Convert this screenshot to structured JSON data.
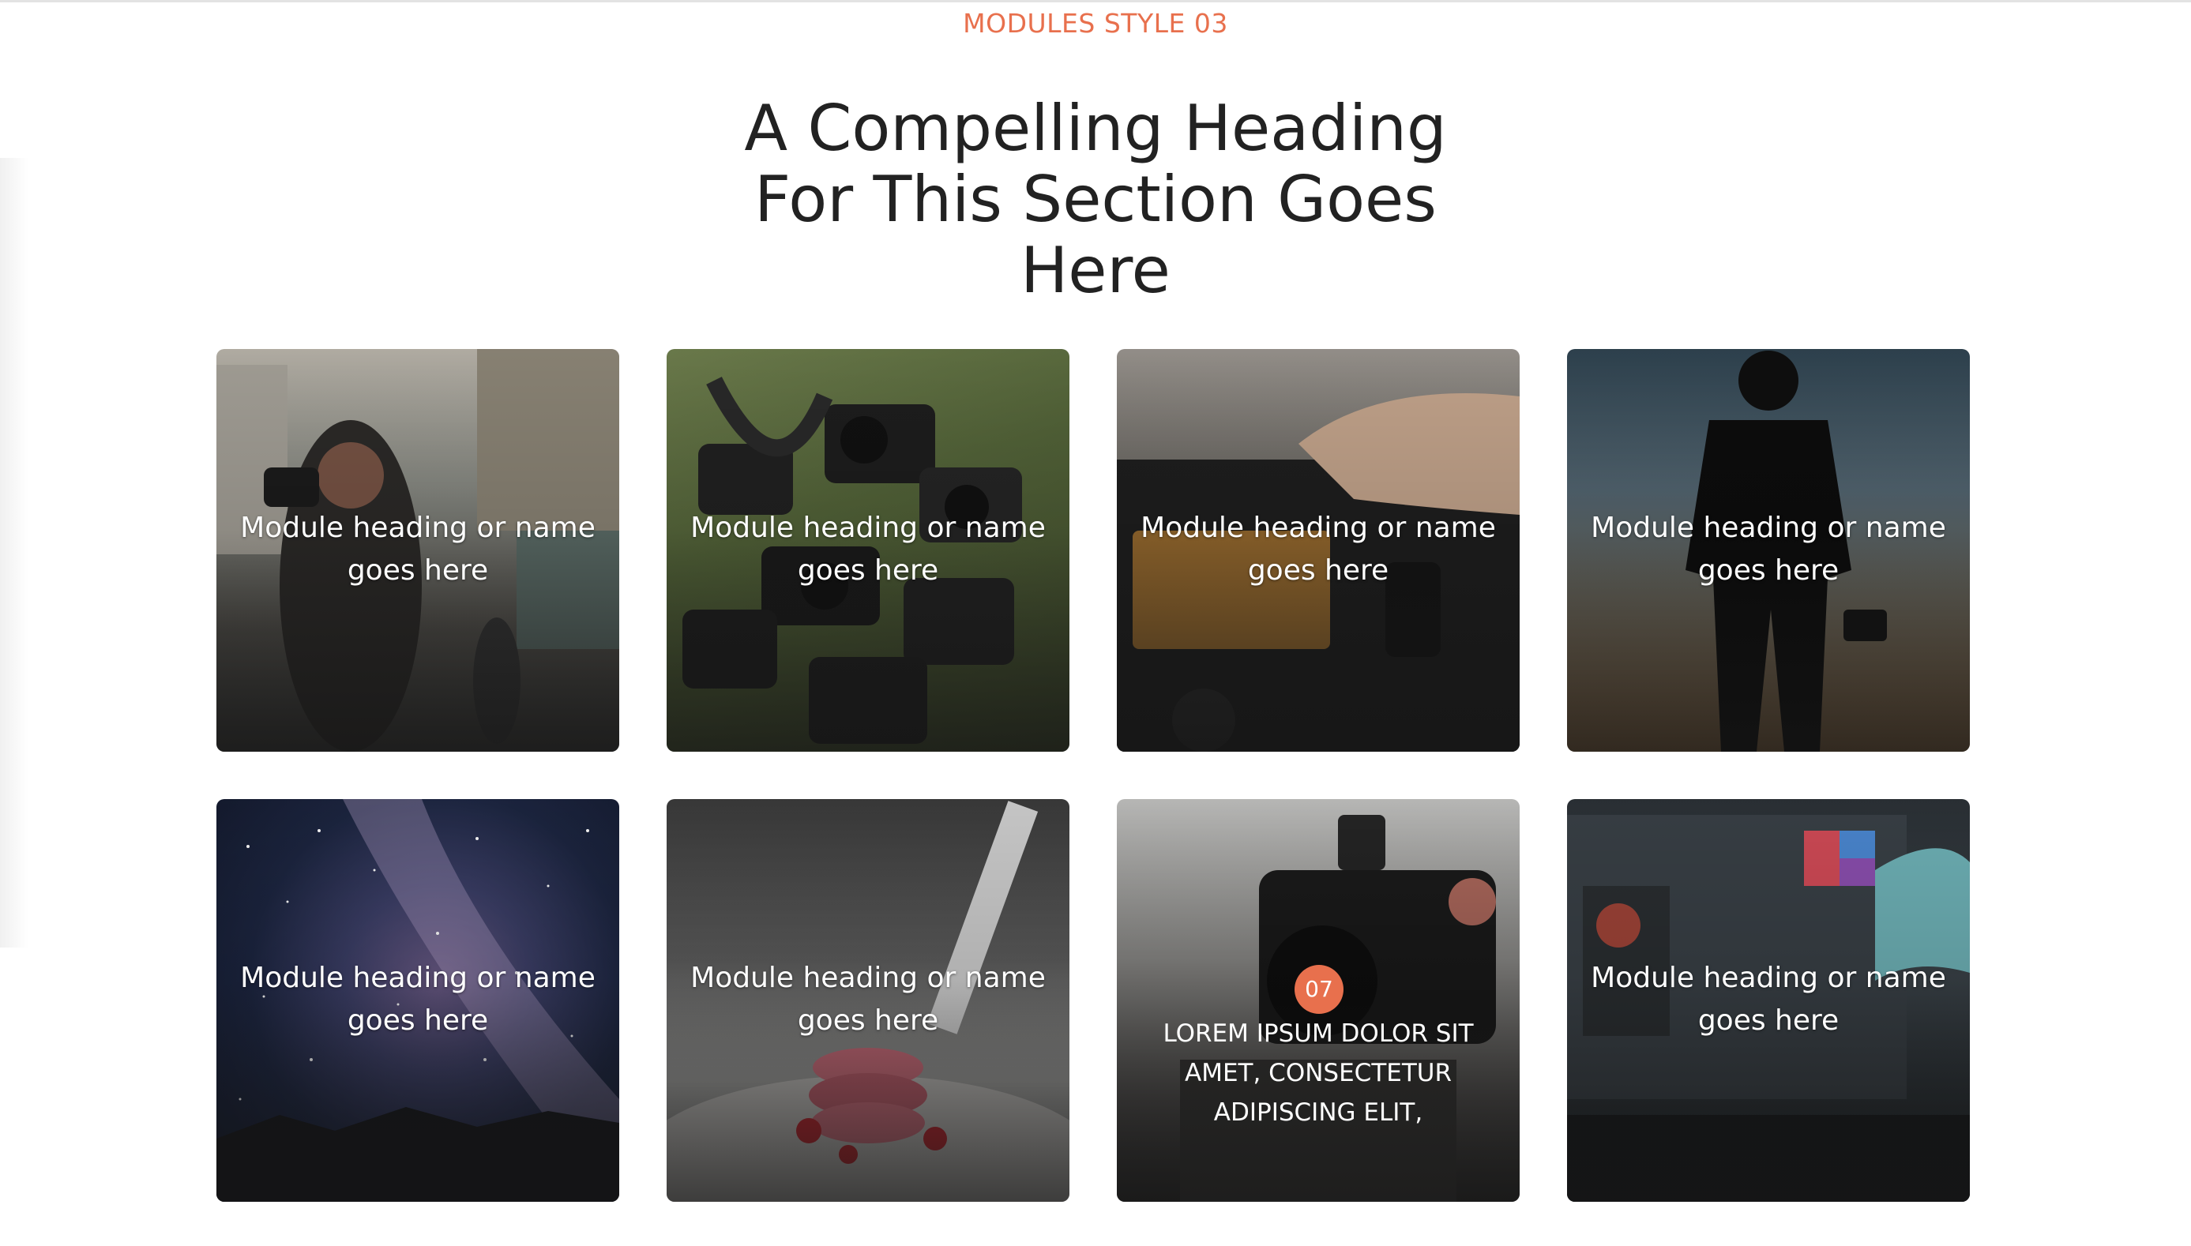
{
  "section": {
    "eyebrow": "MODULES STYLE 03",
    "heading": "A Compelling Heading For This Section Goes Here"
  },
  "cards": [
    {
      "title": "Module heading or name goes here",
      "image": "street-photographer"
    },
    {
      "title": "Module heading or name goes here",
      "image": "cameras-on-grass"
    },
    {
      "title": "Module heading or name goes here",
      "image": "camera-lcd-closeup"
    },
    {
      "title": "Module heading or name goes here",
      "image": "silhouette-with-camera"
    },
    {
      "title": "Module heading or name goes here",
      "image": "milky-way"
    },
    {
      "title": "Module heading or name goes here",
      "image": "donut-photoshoot"
    },
    {
      "badge": "07",
      "body": "LOREM IPSUM DOLOR SIT AMET, CONSECTETUR ADIPISCING ELIT,",
      "image": "camera-rig"
    },
    {
      "title": "Module heading or name goes here",
      "image": "photo-editing-laptop"
    }
  ],
  "colors": {
    "accent": "#e8704d",
    "heading": "#222222"
  }
}
